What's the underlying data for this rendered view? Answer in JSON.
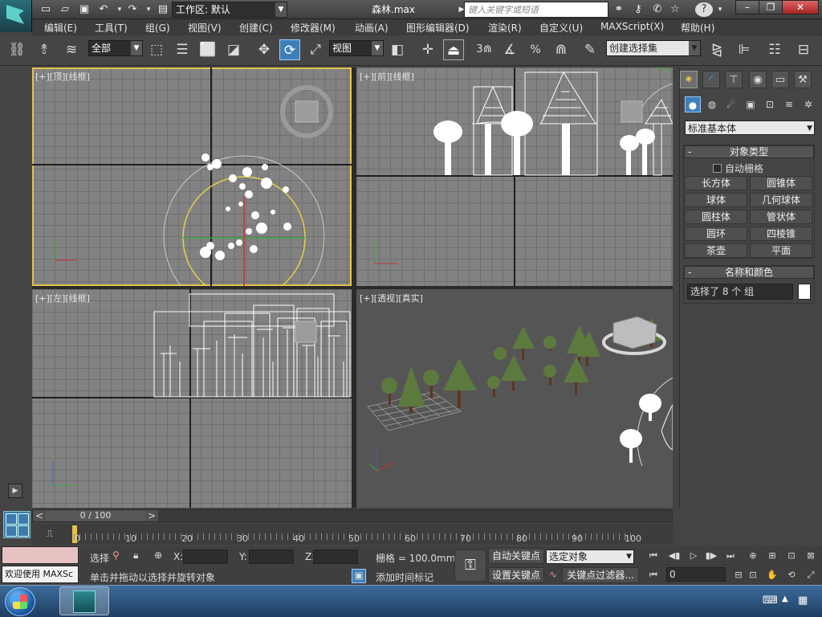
{
  "title_bar": {
    "workspace_value": "工作区: 默认",
    "document_title": "森林.max",
    "search_placeholder": "键入关键字或短语",
    "min_icon": "minimize-icon",
    "max_icon": "maximize-icon",
    "close_icon": "close-icon"
  },
  "menu": {
    "items": [
      "编辑(E)",
      "工具(T)",
      "组(G)",
      "视图(V)",
      "创建(C)",
      "修改器(M)",
      "动画(A)",
      "图形编辑器(D)",
      "渲染(R)",
      "自定义(U)",
      "MAXScript(X)",
      "帮助(H)"
    ]
  },
  "toolbar": {
    "filter_value": "全部",
    "reference_coord_value": "视图",
    "snap_label": "3",
    "percent_label": "%",
    "named_selection_placeholder": "创建选择集"
  },
  "viewports": {
    "top": {
      "label": "[+][顶][线框]"
    },
    "front": {
      "label": "[+][前][线框]"
    },
    "left": {
      "label": "[+][左][线框]"
    },
    "perspective": {
      "label": "[+][透视][真实]"
    }
  },
  "command_panel": {
    "category_value": "标准基本体",
    "object_type": {
      "header": "对象类型",
      "autogrid_label": "自动栅格",
      "buttons": [
        "长方体",
        "圆锥体",
        "球体",
        "几何球体",
        "圆柱体",
        "管状体",
        "圆环",
        "四棱锥",
        "茶壶",
        "平面"
      ]
    },
    "name_color": {
      "header": "名称和颜色",
      "name_value": "选择了 8 个 组",
      "swatch_color": "#ffffff"
    }
  },
  "timeline": {
    "slider_value": "0 / 100",
    "tick_labels": [
      "0",
      "10",
      "20",
      "30",
      "40",
      "50",
      "60",
      "70",
      "80",
      "90",
      "100"
    ]
  },
  "status": {
    "welcome_text": "欢迎使用 MAXSc",
    "selection_label": "选择",
    "x_label": "X:",
    "y_label": "Y:",
    "z_label": "Z:",
    "grid_label": "栅格 = 100.0mm",
    "prompt_text": "单击并拖动以选择并旋转对象",
    "add_time_tag": "添加时间标记",
    "auto_key": "自动关键点",
    "set_key": "设置关键点",
    "key_mode_value": "选定对象",
    "key_filters": "关键点过滤器...",
    "frame_value": "0"
  },
  "colors": {
    "active_viewport_border": "#e3c34b",
    "active_button": "#3e7fb8"
  }
}
